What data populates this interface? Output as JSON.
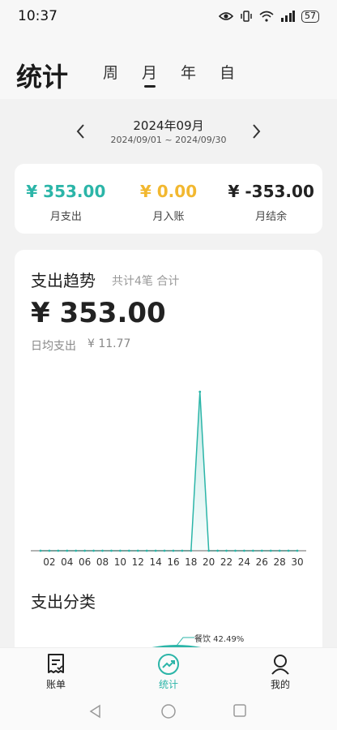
{
  "status": {
    "time": "10:37",
    "battery": "57"
  },
  "header": {
    "title": "统计",
    "tabs": [
      {
        "label": "周",
        "active": false
      },
      {
        "label": "月",
        "active": true
      },
      {
        "label": "年",
        "active": false
      },
      {
        "label": "自",
        "active": false
      }
    ]
  },
  "period": {
    "label": "2024年09月",
    "range": "2024/09/01 ~ 2024/09/30"
  },
  "summary": {
    "expense": {
      "value": "¥ 353.00",
      "label": "月支出",
      "color": "#2bb5a8"
    },
    "income": {
      "value": "¥ 0.00",
      "label": "月入账",
      "color": "#f2b830"
    },
    "balance": {
      "value": "¥ -353.00",
      "label": "月结余",
      "color": "#222222"
    }
  },
  "trend": {
    "title": "支出趋势",
    "subtitle": "共计4笔 合计",
    "total": "¥ 353.00",
    "avg_label": "日均支出",
    "avg_value": "¥ 11.77"
  },
  "chart_data": {
    "type": "area",
    "x": [
      "01",
      "02",
      "03",
      "04",
      "05",
      "06",
      "07",
      "08",
      "09",
      "10",
      "11",
      "12",
      "13",
      "14",
      "15",
      "16",
      "17",
      "18",
      "19",
      "20",
      "21",
      "22",
      "23",
      "24",
      "25",
      "26",
      "27",
      "28",
      "29",
      "30"
    ],
    "values": [
      0,
      0,
      0,
      0,
      0,
      0,
      0,
      0,
      0,
      0,
      0,
      0,
      0,
      0,
      0,
      0,
      0,
      0,
      353,
      0,
      0,
      0,
      0,
      0,
      0,
      0,
      0,
      0,
      0,
      0
    ],
    "tick_labels": [
      "02",
      "04",
      "06",
      "08",
      "10",
      "12",
      "14",
      "16",
      "18",
      "20",
      "22",
      "24",
      "26",
      "28",
      "30"
    ],
    "ylim": [
      0,
      380
    ],
    "color": "#2bb5a8",
    "grid": false
  },
  "category": {
    "title": "支出分类",
    "pie_label": "餐饮 42.49%"
  },
  "bottom_nav": [
    {
      "label": "账单",
      "icon": "bill-icon",
      "active": false
    },
    {
      "label": "统计",
      "icon": "trend-icon",
      "active": true
    },
    {
      "label": "我的",
      "icon": "profile-icon",
      "active": false
    }
  ],
  "accent": "#2bb5a8"
}
